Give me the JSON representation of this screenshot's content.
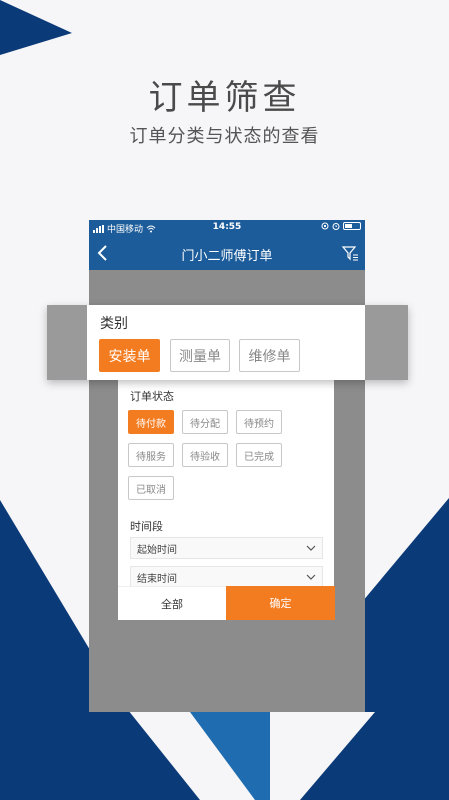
{
  "promo": {
    "title": "订单筛查",
    "subtitle": "订单分类与状态的查看"
  },
  "colors": {
    "accent": "#f47c20",
    "nav": "#1c5c9a",
    "decor_dark": "#0b3a78",
    "decor_light": "#1f6db0"
  },
  "status_bar": {
    "carrier": "中国移动",
    "time": "14:55"
  },
  "nav": {
    "title": "门小二师傅订单",
    "back_icon": "chevron-left-icon",
    "filter_icon": "filter-icon"
  },
  "category": {
    "label": "类别",
    "options": [
      "安装单",
      "测量单",
      "维修单"
    ],
    "selected": "安装单"
  },
  "order_status": {
    "label": "订单状态",
    "options": [
      "待付款",
      "待分配",
      "待预约",
      "待服务",
      "待验收",
      "已完成",
      "已取消"
    ],
    "selected": "待付款"
  },
  "time_range": {
    "label": "时间段",
    "start_placeholder": "起始时间",
    "end_placeholder": "结束时间"
  },
  "footer": {
    "all_label": "全部",
    "confirm_label": "确定"
  }
}
